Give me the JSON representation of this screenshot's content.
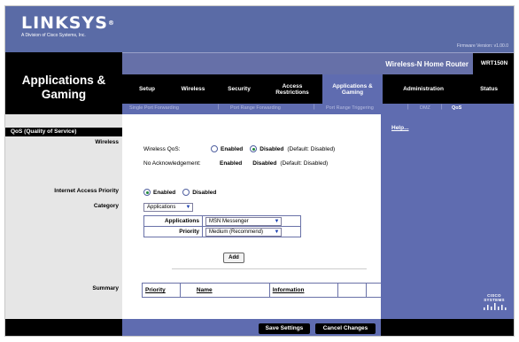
{
  "brand": {
    "logo": "LINKSYS",
    "logo_mark": "®",
    "tagline": "A Division of Cisco Systems, Inc.",
    "firmware": "Firmware Version: v1.00.0"
  },
  "section_title_line1": "Applications &",
  "section_title_line2": "Gaming",
  "product_name": "Wireless-N Home Router",
  "model": "WRT150N",
  "tabs": [
    {
      "label": "Setup"
    },
    {
      "label": "Wireless"
    },
    {
      "label": "Security"
    },
    {
      "label1": "Access",
      "label2": "Restrictions"
    },
    {
      "label1": "Applications &",
      "label2": "Gaming"
    },
    {
      "label": "Administration"
    },
    {
      "label": "Status"
    }
  ],
  "subtabs": [
    "Single Port Forwarding",
    "Port Range Forwarding",
    "Port Range Triggering",
    "DMZ",
    "QoS"
  ],
  "subtab_sep": "|",
  "left_labels": {
    "qos_heading": "QoS (Quality of Service)",
    "wireless": "Wireless",
    "internet_access_priority": "Internet Access Priority",
    "category": "Category",
    "summary": "Summary"
  },
  "wireless_qos": {
    "label": "Wireless QoS:",
    "enabled": "Enabled",
    "disabled": "Disabled",
    "default": "(Default: Disabled)"
  },
  "no_ack": {
    "label": "No Acknowledgement:",
    "enabled": "Enabled",
    "disabled": "Disabled",
    "default": "(Default: Disabled)"
  },
  "iap": {
    "enabled": "Enabled",
    "disabled": "Disabled"
  },
  "category_select": "Applications",
  "applications_label": "Applications",
  "applications_select": "MSN Messenger",
  "priority_label": "Priority",
  "priority_select": "Medium (Recommend)",
  "add_button": "Add",
  "summary_headers": [
    "Priority",
    "Name",
    "Information"
  ],
  "help_link": "Help...",
  "cisco_text": "CISCO SYSTEMS",
  "save_button": "Save Settings",
  "cancel_button": "Cancel Changes",
  "colors": {
    "header_blue": "#5a6ba6",
    "panel_blue": "#5f6cb0",
    "radio_green": "#1f8a3a"
  }
}
